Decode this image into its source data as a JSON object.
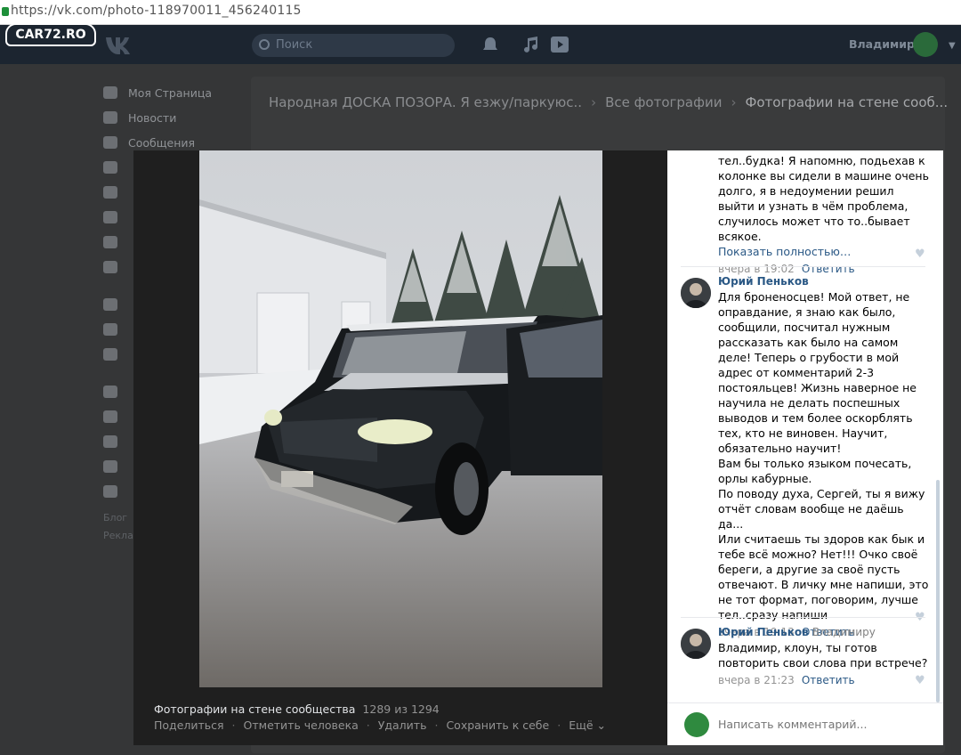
{
  "browser": {
    "url": "https://vk.com/photo-118970011_456240115"
  },
  "watermark": {
    "text": "CAR72.RO"
  },
  "header": {
    "search_placeholder": "Поиск",
    "username": "Владимир"
  },
  "left_menu": {
    "items": [
      {
        "label": "Моя Страница",
        "icon": "home-icon"
      },
      {
        "label": "Новости",
        "icon": "news-icon"
      },
      {
        "label": "Сообщения",
        "icon": "messages-icon"
      }
    ],
    "footer": [
      "Блог",
      "Рекла"
    ]
  },
  "breadcrumbs": {
    "items": [
      "Народная ДОСКА ПОЗОРА. Я езжу/паркуюс..",
      "Все фотографии"
    ],
    "current": "Фотографии на стене сооб..."
  },
  "viewer": {
    "album_title": "Фотографии на стене сообщества",
    "counter": "1289 из 1294",
    "actions": [
      "Поделиться",
      "Отметить человека",
      "Удалить",
      "Сохранить к себе",
      "Ещё ⌄"
    ]
  },
  "comments": [
    {
      "author": "",
      "text": "тел..будка! Я напомню, подьехав к колонке вы сидели в машине очень долго, я в недоумении решил выйти и узнать в чём проблема, случилось может что то..бывает всякое.",
      "more": "Показать полностью…",
      "time": "вчера в 19:02",
      "reply": "Ответить"
    },
    {
      "author": "Юрий Пеньков",
      "text": "Для броненосцев! Мой ответ, не оправдание, я знаю как было, сообщили, посчитал нужным рассказать как было на самом деле! Теперь о грубости в мой адрес от комментарий 2-3 постояльцев! Жизнь наверное не научила не делать поспешных выводов и тем более оскорблять тех, кто не виновен. Научит, обязательно научит!\nВам бы только языком почесать, орлы кабурные.\nПо поводу духа, Сергей, ты я вижу отчёт словам вообще не даёшь да...\nИли считаешь ты здоров как бык и тебе всё можно? Нет!!! Очко своё береги, а другие за своё пусть отвечают. В личку мне напиши, это не тот формат, поговорим, лучше тел..сразу напиши",
      "time": "вчера в 19:13",
      "reply": "Ответить"
    },
    {
      "author": "Юрий Пеньков",
      "reply_to": "Владимиру",
      "text": "Владимир, клоун, ты готов повторить свои слова при встрече?",
      "time": "вчера в 21:23",
      "reply": "Ответить"
    }
  ],
  "comment_input": {
    "placeholder": "Написать комментарий..."
  },
  "colors": {
    "vk_blue": "#2a5885",
    "header_bg": "#1c2530",
    "overlay": "#353637"
  }
}
